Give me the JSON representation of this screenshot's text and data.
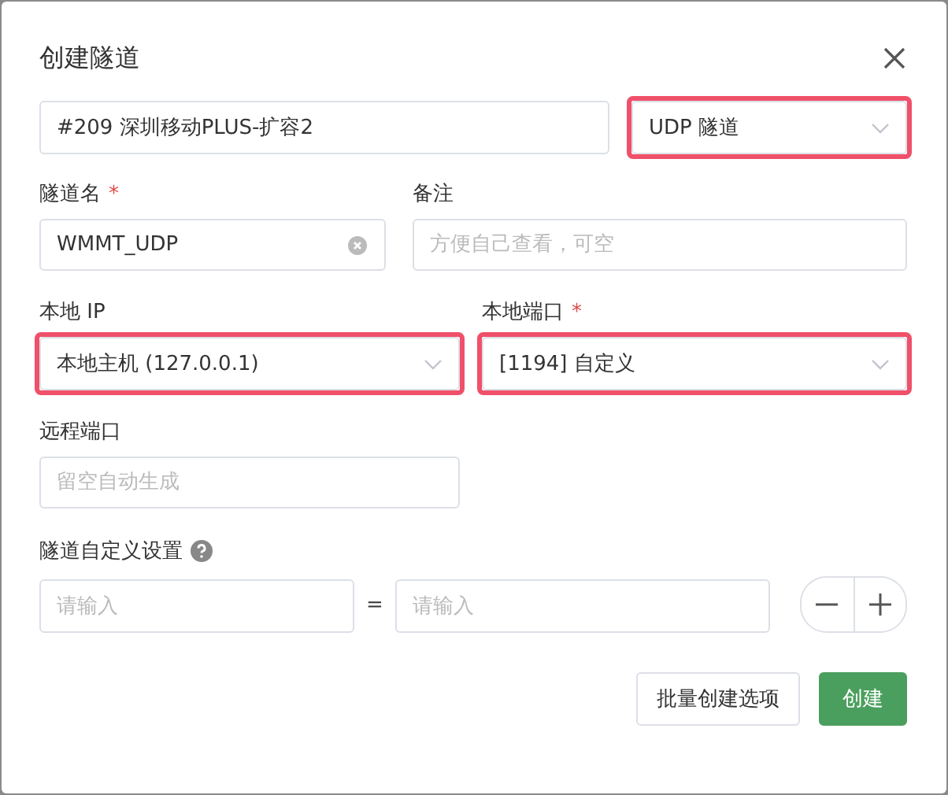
{
  "dialog": {
    "title": "创建隧道"
  },
  "node_field": {
    "value": "#209 深圳移动PLUS-扩容2"
  },
  "type_select": {
    "value": "UDP 隧道",
    "highlighted": true
  },
  "name_field": {
    "label": "隧道名",
    "required_mark": "*",
    "value": "WMMT_UDP"
  },
  "remark_field": {
    "label": "备注",
    "placeholder": "方便自己查看，可空"
  },
  "local_ip_select": {
    "label": "本地 IP",
    "value": "本地主机 (127.0.0.1)",
    "highlighted": true
  },
  "local_port_select": {
    "label": "本地端口",
    "required_mark": "*",
    "value": "[1194] 自定义",
    "highlighted": true
  },
  "remote_port_field": {
    "label": "远程端口",
    "placeholder": "留空自动生成"
  },
  "custom_settings": {
    "label": "隧道自定义设置",
    "key_placeholder": "请输入",
    "separator": "=",
    "value_placeholder": "请输入"
  },
  "buttons": [
    {
      "label": "批量创建选项",
      "kind": "default"
    },
    {
      "label": "创建",
      "kind": "primary"
    }
  ]
}
